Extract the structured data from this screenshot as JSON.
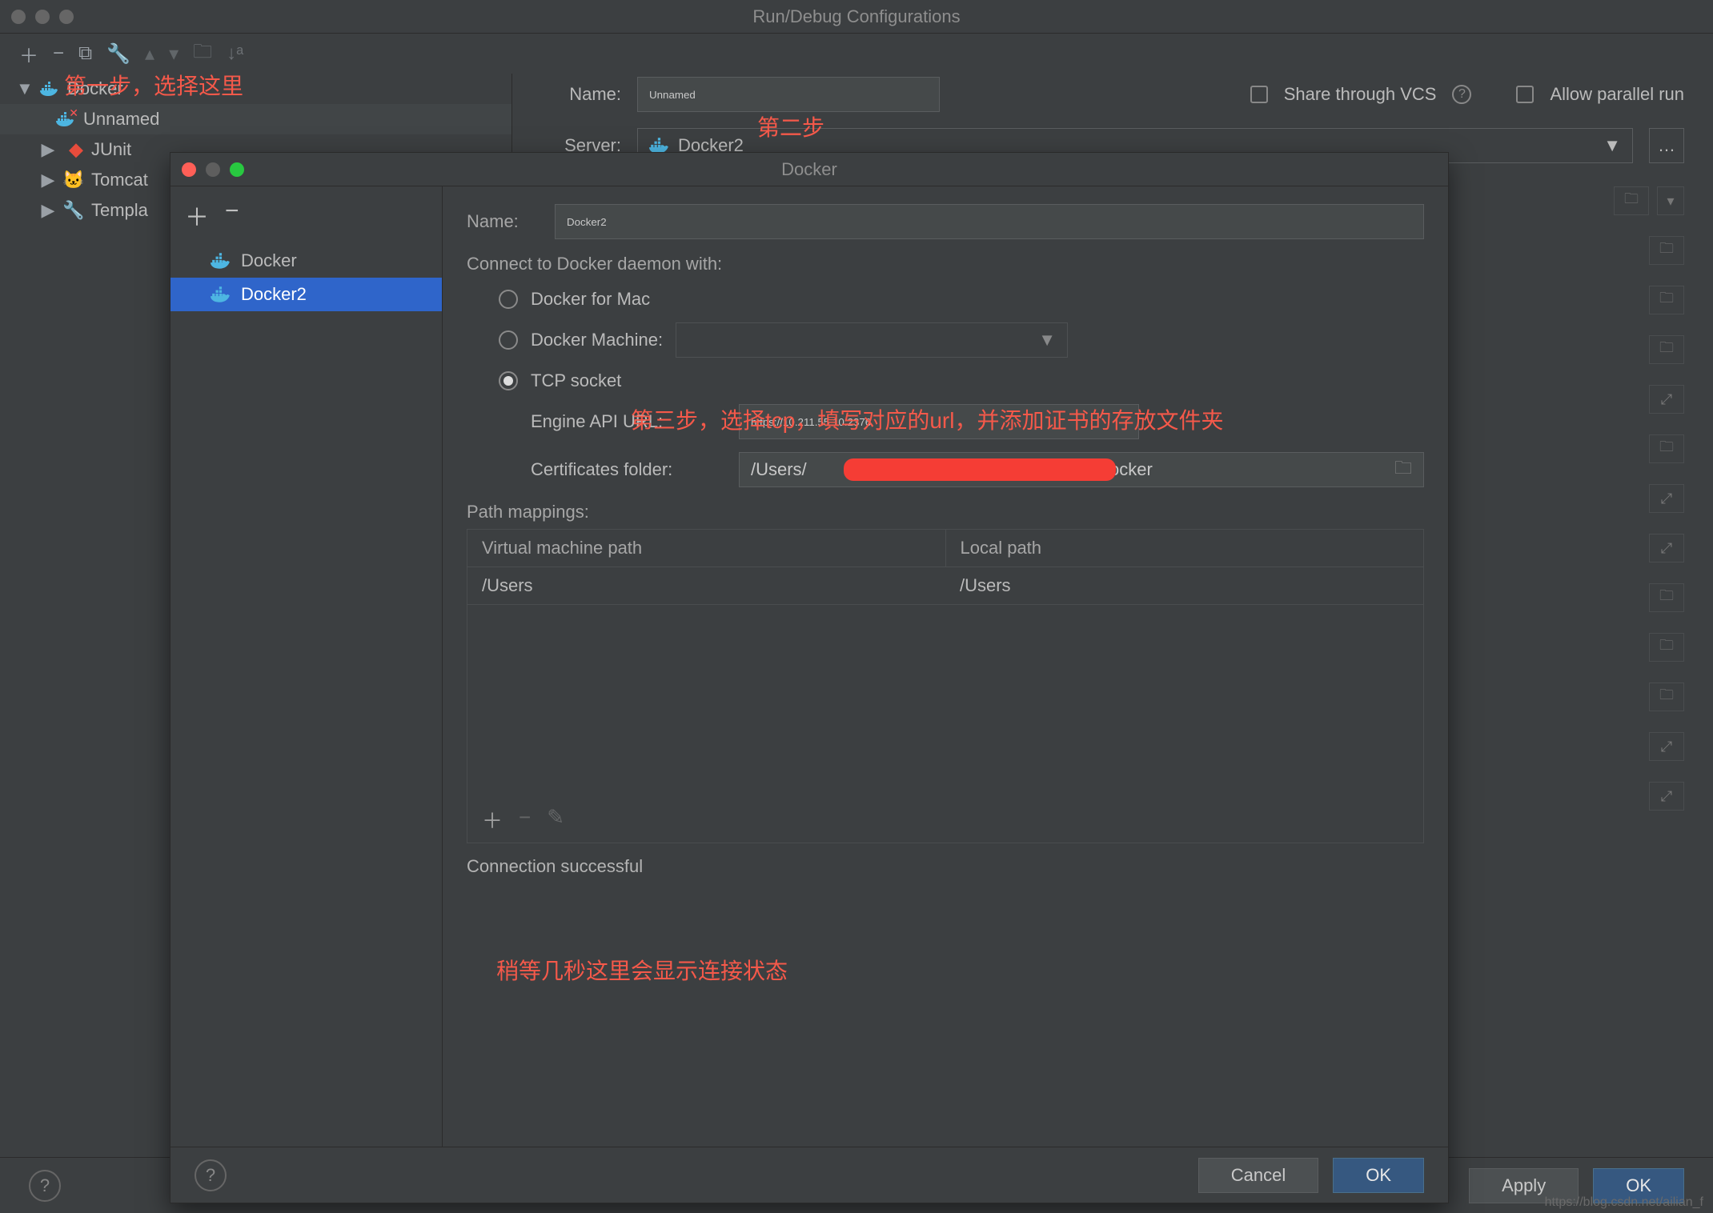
{
  "outer": {
    "title": "Run/Debug Configurations",
    "name_label": "Name:",
    "name_value": "Unnamed",
    "share_label": "Share through VCS",
    "parallel_label": "Allow parallel run",
    "server_label": "Server:",
    "server_value": "Docker2",
    "tree": {
      "docker": "Docker",
      "unnamed": "Unnamed",
      "junit": "JUnit",
      "tomcat": "Tomcat",
      "templates": "Templa"
    },
    "apply": "Apply",
    "ok": "OK"
  },
  "modal": {
    "title": "Docker",
    "list": {
      "docker": "Docker",
      "docker2": "Docker2"
    },
    "name_label": "Name:",
    "name_value": "Docker2",
    "connect_label": "Connect to Docker daemon with:",
    "opt_mac": "Docker for Mac",
    "opt_machine": "Docker Machine:",
    "opt_tcp": "TCP socket",
    "engine_label": "Engine API URL:",
    "engine_value": "https://10.211.55.10:2376",
    "cert_label": "Certificates folder:",
    "cert_prefix": "/Users/",
    "cert_suffix": "/docker",
    "path_label": "Path mappings:",
    "th_vm": "Virtual machine path",
    "th_local": "Local path",
    "td_vm": "/Users",
    "td_local": "/Users",
    "status": "Connection successful",
    "cancel": "Cancel",
    "ok": "OK"
  },
  "annotations": {
    "a1": "第一步，选择这里",
    "a2": "第二步",
    "a3": "第三步，选择tcp，填写对应的url，并添加证书的存放文件夹",
    "a4": "稍等几秒这里会显示连接状态"
  },
  "watermark": "https://blog.csdn.net/ailian_f"
}
